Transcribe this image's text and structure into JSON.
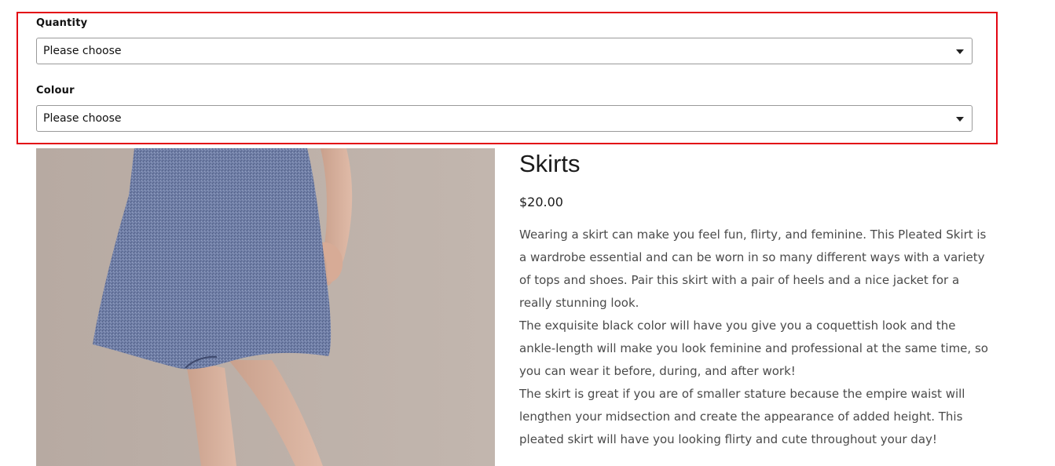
{
  "options_form": {
    "quantity": {
      "label": "Quantity",
      "selected": "Please choose"
    },
    "colour": {
      "label": "Colour",
      "selected": "Please choose"
    },
    "highlight_color": "#e30613"
  },
  "product": {
    "title": "Skirts",
    "price": "$20.00",
    "description": [
      "Wearing a skirt can make you feel fun, flirty, and feminine. This Pleated Skirt is a wardrobe essential and can be worn in so many different ways with a variety of tops and shoes. Pair this skirt with a pair of heels and a nice jacket for a really stunning look.",
      "The exquisite black color will have you give you a coquettish look and the ankle-length will make you look feminine and professional at the same time, so you can wear it before, during, and after work!",
      "The skirt is great if you are of smaller stature because the empire waist will lengthen your midsection and create the appearance of added height. This pleated skirt will have you looking flirty and cute throughout your day!"
    ]
  }
}
